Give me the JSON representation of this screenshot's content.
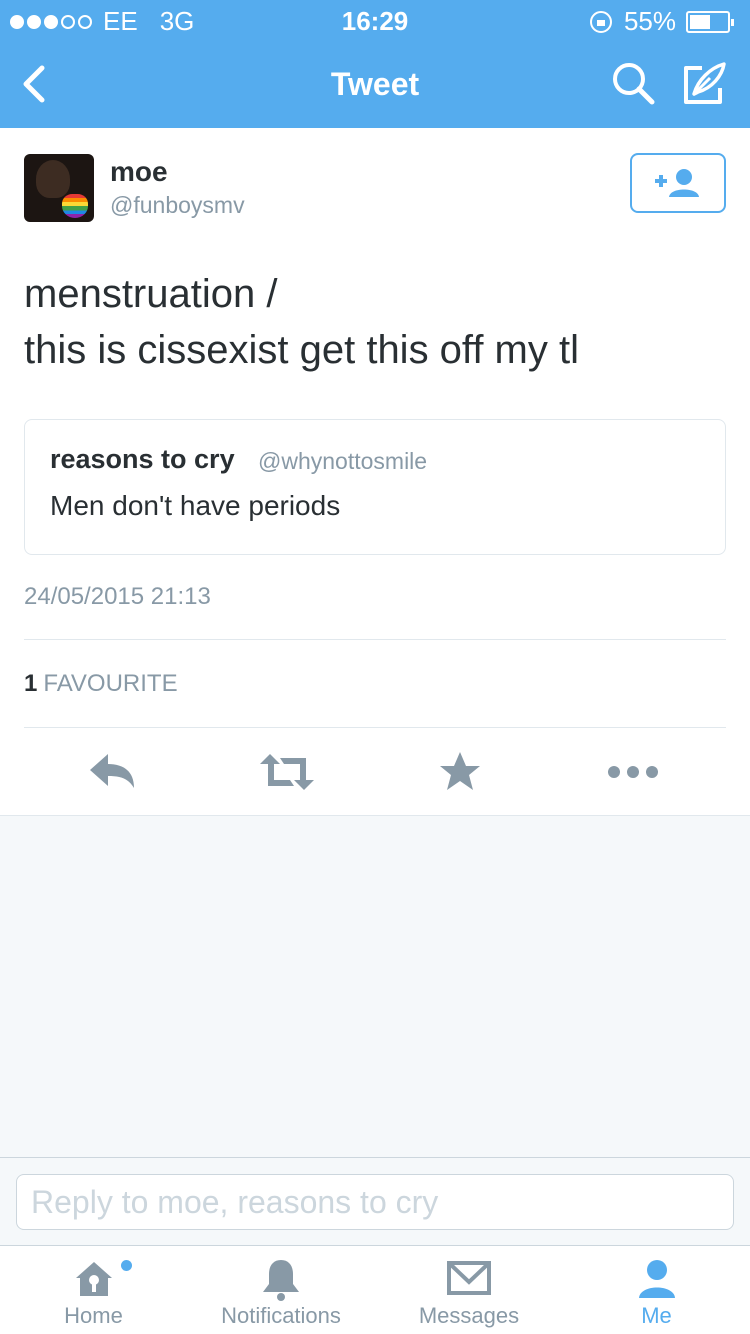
{
  "status_bar": {
    "carrier": "EE",
    "network": "3G",
    "time": "16:29",
    "battery": "55%",
    "battery_level": 0.55,
    "signal_bars_filled": 3,
    "signal_bars_total": 5
  },
  "nav": {
    "title": "Tweet",
    "back_icon": "chevron-left-icon",
    "search_icon": "search-icon",
    "compose_icon": "compose-quill-icon"
  },
  "tweet": {
    "display_name": "moe",
    "username": "@funboysmv",
    "text_line1": "menstruation /",
    "text_line2": "this is cissexist get this off my tl",
    "quoted": {
      "name": "reasons to cry",
      "handle": "@whynottosmile",
      "text": "Men don't have periods"
    },
    "timestamp": "24/05/2015 21:13",
    "favourite_count": "1",
    "favourite_label": "FAVOURITE"
  },
  "actions": [
    "reply-icon",
    "retweet-icon",
    "favorite-star-icon",
    "more-dots-icon"
  ],
  "reply": {
    "placeholder": "Reply to moe, reasons to cry"
  },
  "tabs": [
    {
      "label": "Home",
      "icon": "home-icon",
      "active": false
    },
    {
      "label": "Notifications",
      "icon": "bell-icon",
      "active": false
    },
    {
      "label": "Messages",
      "icon": "envelope-icon",
      "active": false
    },
    {
      "label": "Me",
      "icon": "person-icon",
      "active": true
    }
  ],
  "colors": {
    "brand": "#55acee",
    "text": "#292f33",
    "secondary": "#8899a6",
    "border": "#e1e8ed"
  }
}
